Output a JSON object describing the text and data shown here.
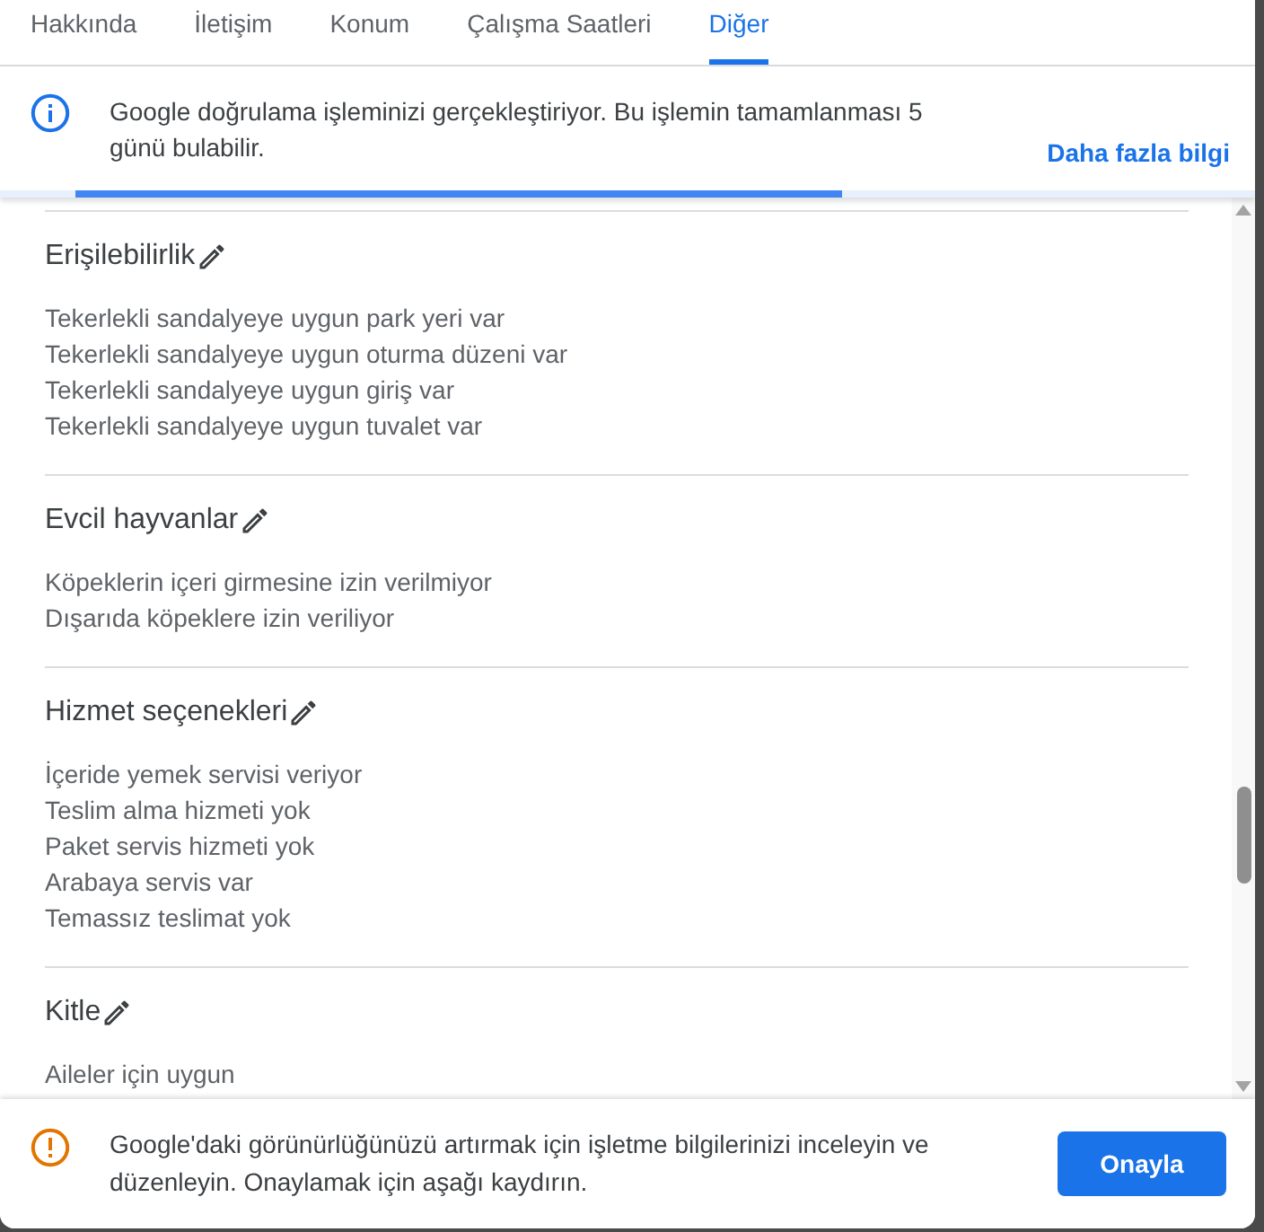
{
  "tabs": [
    {
      "label": "Hakkında",
      "selected": false
    },
    {
      "label": "İletişim",
      "selected": false
    },
    {
      "label": "Konum",
      "selected": false
    },
    {
      "label": "Çalışma Saatleri",
      "selected": false
    },
    {
      "label": "Diğer",
      "selected": true
    }
  ],
  "info_banner": {
    "text": "Google doğrulama işleminizi gerçekleştiriyor. Bu işlemin tamamlanması 5 günü bulabilir.",
    "link": "Daha fazla bilgi",
    "progress": {
      "level": 0.65
    }
  },
  "sections": [
    {
      "title": "Erişilebilirlik",
      "items": [
        "Tekerlekli sandalyeye uygun park yeri var",
        "Tekerlekli sandalyeye uygun oturma düzeni var",
        "Tekerlekli sandalyeye uygun giriş var",
        "Tekerlekli sandalyeye uygun tuvalet var"
      ]
    },
    {
      "title": "Evcil hayvanlar",
      "items": [
        "Köpeklerin içeri girmesine izin verilmiyor",
        "Dışarıda köpeklere izin veriliyor"
      ]
    },
    {
      "title": "Hizmet seçenekleri",
      "items": [
        "İçeride yemek servisi veriyor",
        "Teslim alma hizmeti yok",
        "Paket servis hizmeti yok",
        "Arabaya servis var",
        "Temassız teslimat yok"
      ]
    },
    {
      "title": "Kitle",
      "items": [
        "Aileler için uygun"
      ]
    }
  ],
  "footer": {
    "text": "Google'daki görünürlüğünüzü artırmak için işletme bilgilerinizi inceleyin ve düzenleyin. Onaylamak için aşağı kaydırın.",
    "button": "Onayla"
  }
}
